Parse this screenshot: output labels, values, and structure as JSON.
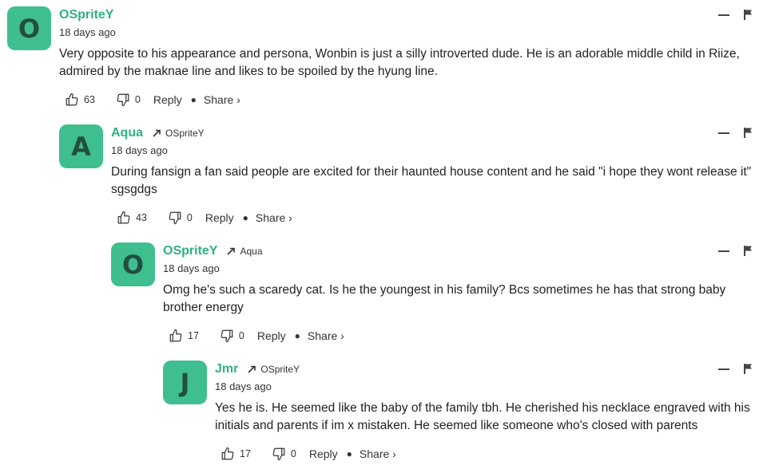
{
  "colors": {
    "accent": "#2eb27f",
    "avatar_bg": "#3fbf8f",
    "avatar_text": "#234f3f"
  },
  "comments": [
    {
      "avatar_letter": "O",
      "author": "OSpriteY",
      "reply_to": "",
      "time": "18 days ago",
      "text": "Very opposite to his appearance and persona, Wonbin is just a silly introverted dude. He is an adorable middle child in Riize, admired by the maknae line and likes to be spoiled by the hyung line.",
      "upvotes": "63",
      "downvotes": "0",
      "reply_label": "Reply",
      "share_label": "Share ›"
    },
    {
      "avatar_letter": "A",
      "author": "Aqua",
      "reply_to": "OSpriteY",
      "time": "18 days ago",
      "text": "During fansign a fan said people are excited for their haunted house content and he said \"i hope they wont release it\" sgsgdgs",
      "upvotes": "43",
      "downvotes": "0",
      "reply_label": "Reply",
      "share_label": "Share ›"
    },
    {
      "avatar_letter": "O",
      "author": "OSpriteY",
      "reply_to": "Aqua",
      "time": "18 days ago",
      "text": "Omg he's such a scaredy cat. Is he the youngest in his family? Bcs sometimes he has that strong baby brother energy",
      "upvotes": "17",
      "downvotes": "0",
      "reply_label": "Reply",
      "share_label": "Share ›"
    },
    {
      "avatar_letter": "J",
      "author": "Jmr",
      "reply_to": "OSpriteY",
      "time": "18 days ago",
      "text": "Yes he is. He seemed like the baby of the family tbh. He cherished his necklace engraved with his initials and parents if im x mistaken. He seemed like someone who's closed with parents",
      "upvotes": "17",
      "downvotes": "0",
      "reply_label": "Reply",
      "share_label": "Share ›"
    }
  ]
}
